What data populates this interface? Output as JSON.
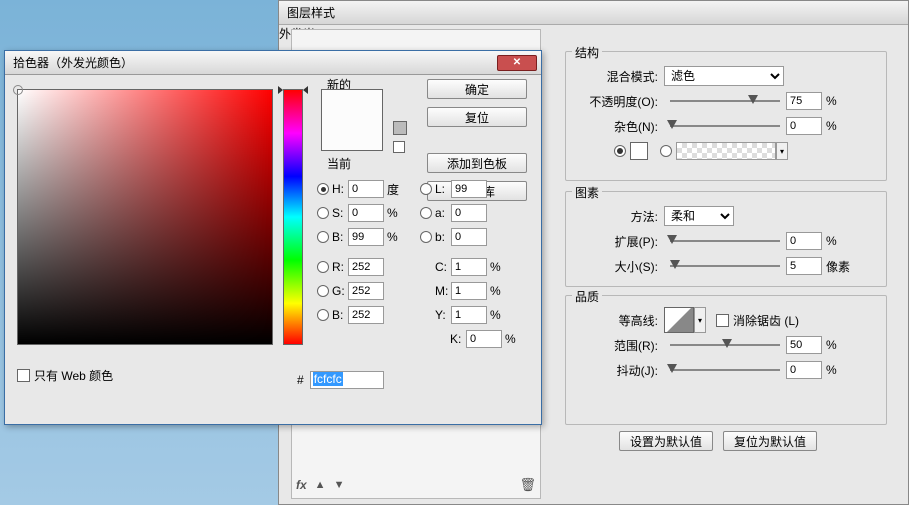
{
  "layerStyle": {
    "title": "图层样式",
    "outerGlow": "外发光",
    "struct": {
      "label": "结构",
      "blendMode": "混合模式:",
      "blendValue": "滤色",
      "opacity": "不透明度(O):",
      "opacityVal": "75",
      "noise": "杂色(N):",
      "noiseVal": "0",
      "pct": "%"
    },
    "elem": {
      "label": "图素",
      "method": "方法:",
      "methodVal": "柔和",
      "spread": "扩展(P):",
      "spreadVal": "0",
      "size": "大小(S):",
      "sizeVal": "5",
      "px": "像素",
      "pct": "%"
    },
    "qual": {
      "label": "品质",
      "contour": "等高线:",
      "antialias": "消除锯齿 (L)",
      "range": "范围(R):",
      "rangeVal": "50",
      "jitter": "抖动(J):",
      "jitterVal": "0",
      "pct": "%"
    },
    "setDefault": "设置为默认值",
    "resetDefault": "复位为默认值"
  },
  "picker": {
    "title": "拾色器（外发光颜色）",
    "new": "新的",
    "current": "当前",
    "ok": "确定",
    "cancel": "复位",
    "addSwatch": "添加到色板",
    "colorLib": "颜色库",
    "webOnly": "只有 Web 颜色",
    "hexPrefix": "#",
    "hex": "fcfcfc",
    "H": "H:",
    "Hval": "0",
    "Hdeg": "度",
    "S": "S:",
    "Sval": "0",
    "Bc": "B:",
    "Bval": "99",
    "L": "L:",
    "Lval": "99",
    "a": "a:",
    "aval": "0",
    "b": "b:",
    "bval": "0",
    "R": "R:",
    "Rval": "252",
    "G": "G:",
    "Gval": "252",
    "Bl": "B:",
    "Blval": "252",
    "C": "C:",
    "Cval": "1",
    "M": "M:",
    "Mval": "1",
    "Y": "Y:",
    "Yval": "1",
    "K": "K:",
    "Kval": "0",
    "pct": "%"
  }
}
